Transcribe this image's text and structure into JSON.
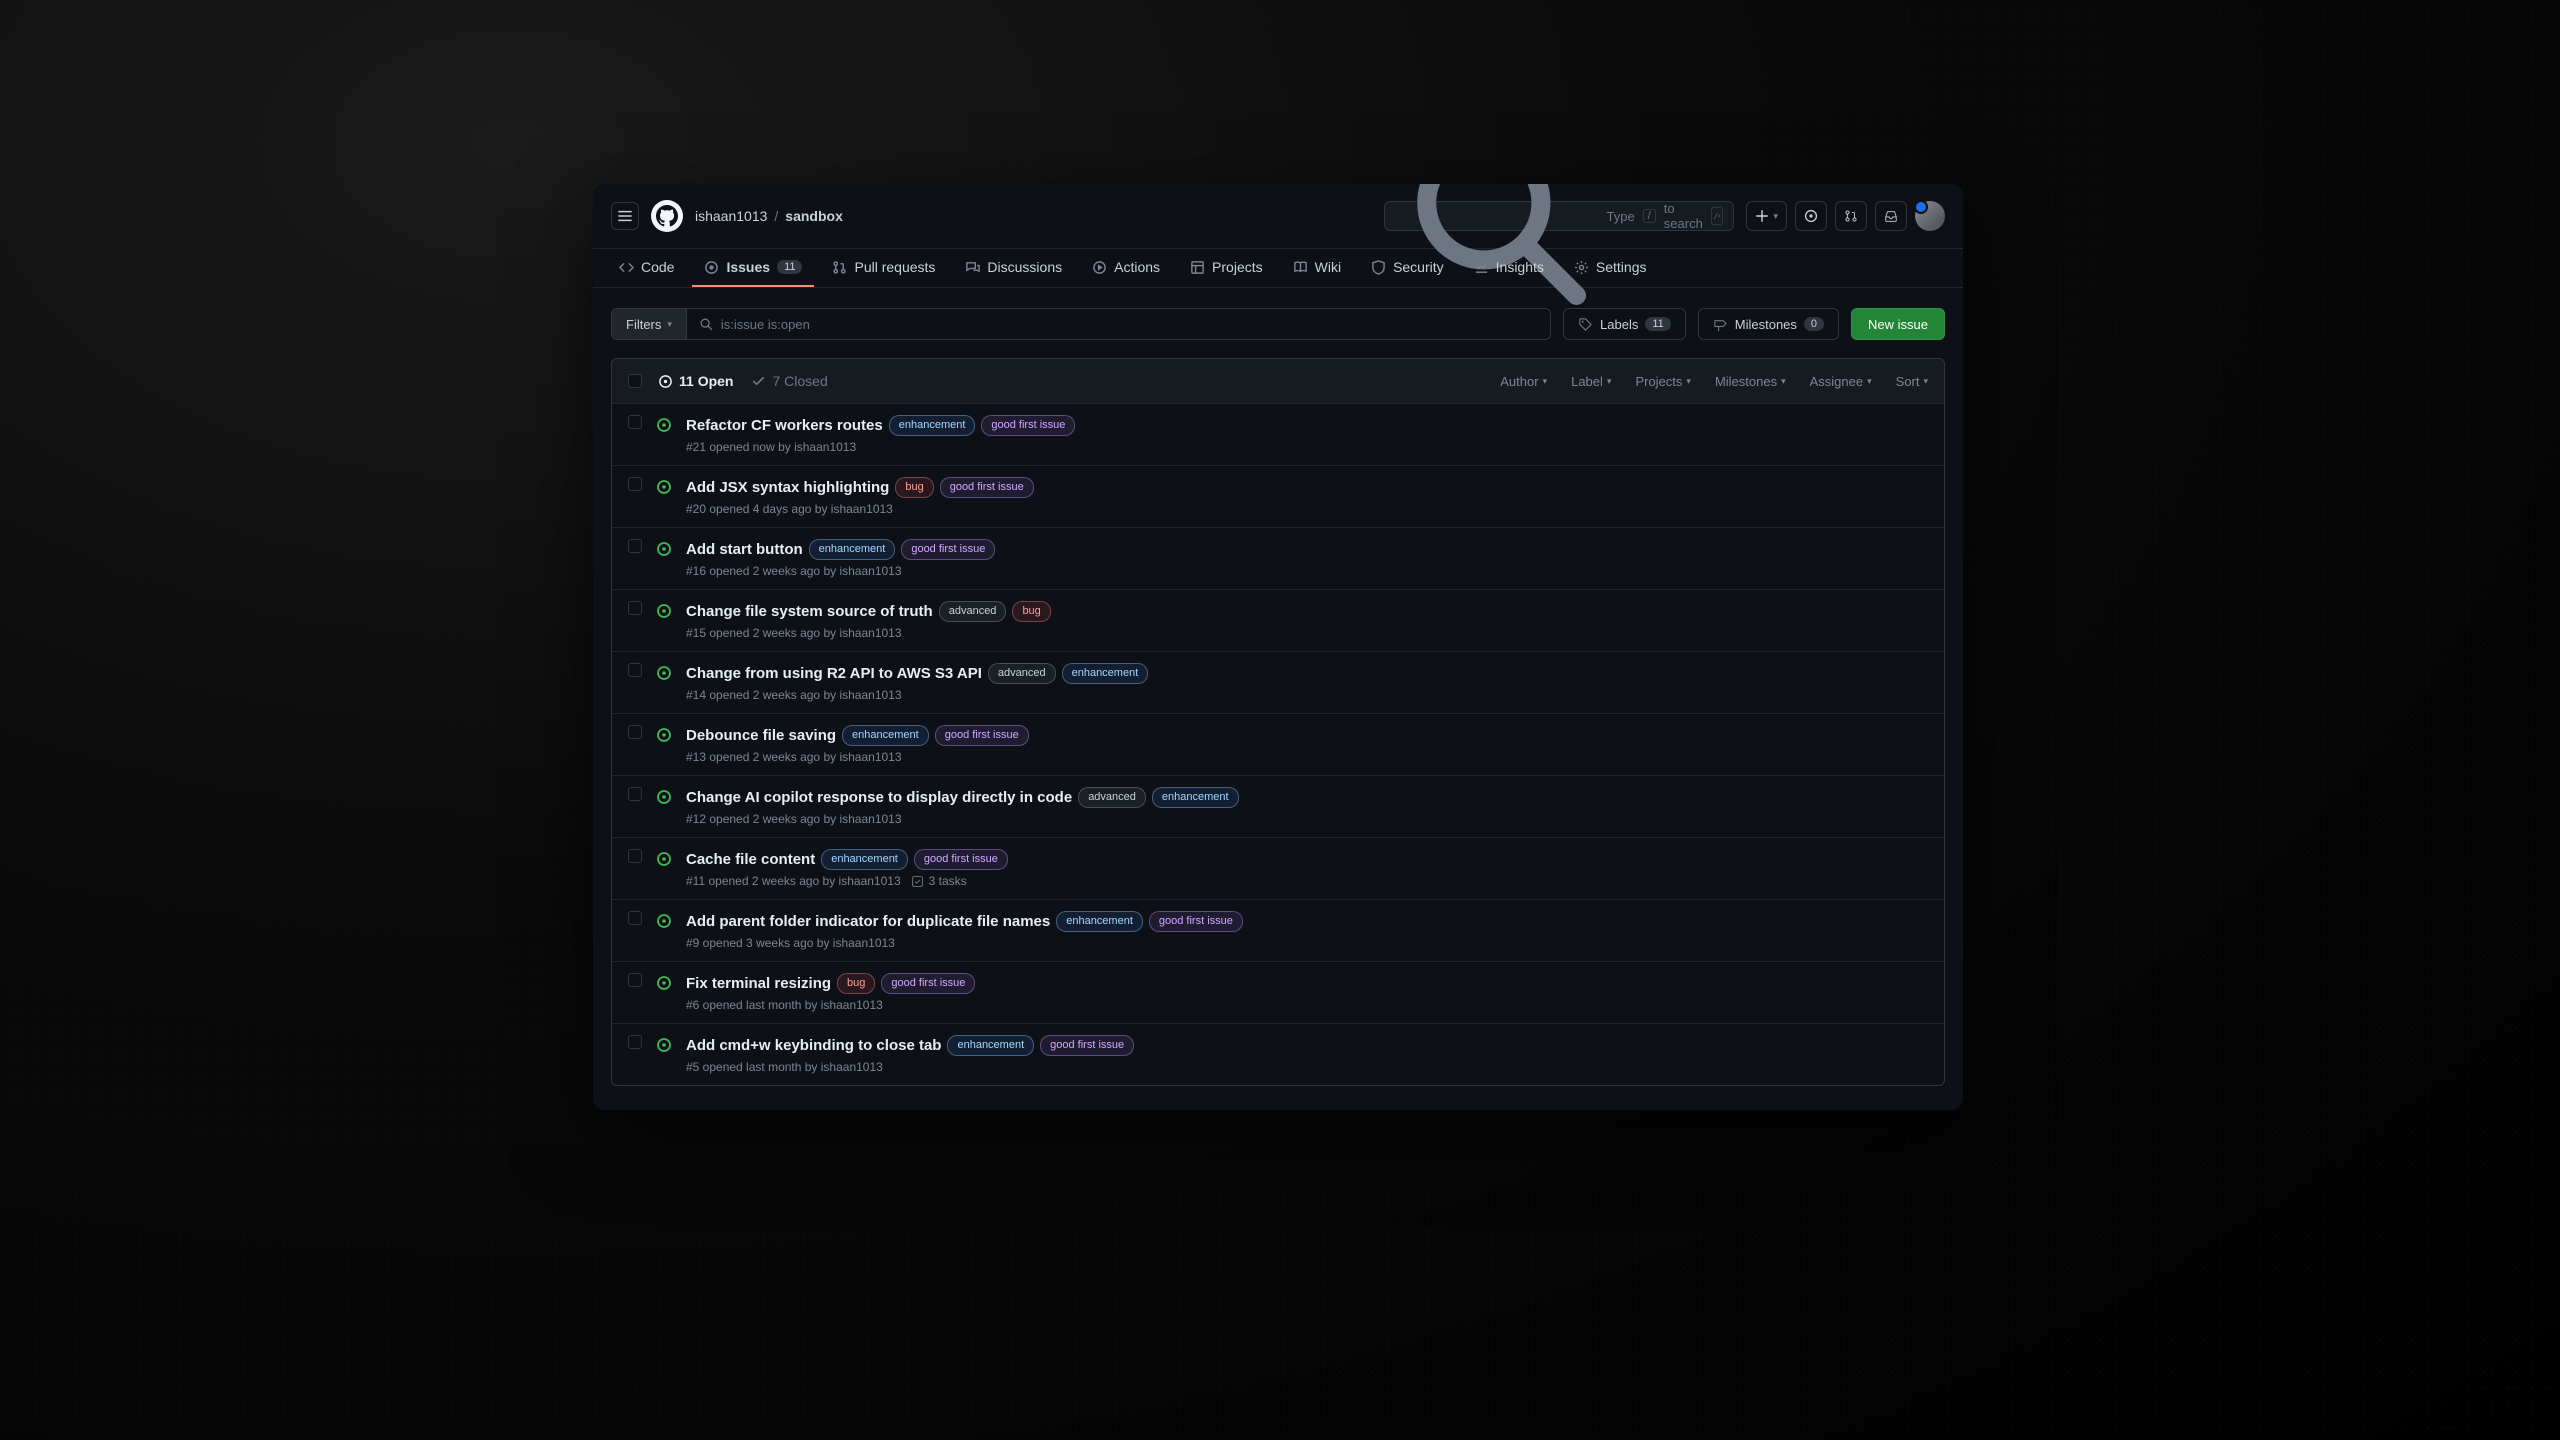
{
  "breadcrumb": {
    "owner": "ishaan1013",
    "repo": "sandbox",
    "sep": "/"
  },
  "search": {
    "prefix": "Type",
    "kbd": "/",
    "suffix": "to search"
  },
  "tabs": {
    "code": "Code",
    "issues": "Issues",
    "issues_count": "11",
    "pulls": "Pull requests",
    "discussions": "Discussions",
    "actions": "Actions",
    "projects": "Projects",
    "wiki": "Wiki",
    "security": "Security",
    "insights": "Insights",
    "settings": "Settings"
  },
  "toolbar": {
    "filters": "Filters",
    "query": "is:issue is:open",
    "labels": "Labels",
    "labels_count": "11",
    "milestones": "Milestones",
    "milestones_count": "0",
    "new_issue": "New issue"
  },
  "list_header": {
    "open": "11 Open",
    "closed": "7 Closed",
    "author": "Author",
    "label": "Label",
    "projects": "Projects",
    "milestones": "Milestones",
    "assignee": "Assignee",
    "sort": "Sort"
  },
  "labels": {
    "enhancement": "enhancement",
    "bug": "bug",
    "good_first_issue": "good first issue",
    "advanced": "advanced"
  },
  "issues": [
    {
      "title": "Refactor CF workers routes",
      "labels": [
        "enhancement",
        "good_first_issue"
      ],
      "meta": "#21 opened now by ishaan1013"
    },
    {
      "title": "Add JSX syntax highlighting",
      "labels": [
        "bug",
        "good_first_issue"
      ],
      "meta": "#20 opened 4 days ago by ishaan1013"
    },
    {
      "title": "Add start button",
      "labels": [
        "enhancement",
        "good_first_issue"
      ],
      "meta": "#16 opened 2 weeks ago by ishaan1013"
    },
    {
      "title": "Change file system source of truth",
      "labels": [
        "advanced",
        "bug"
      ],
      "meta": "#15 opened 2 weeks ago by ishaan1013"
    },
    {
      "title": "Change from using R2 API to AWS S3 API",
      "labels": [
        "advanced",
        "enhancement"
      ],
      "meta": "#14 opened 2 weeks ago by ishaan1013"
    },
    {
      "title": "Debounce file saving",
      "labels": [
        "enhancement",
        "good_first_issue"
      ],
      "meta": "#13 opened 2 weeks ago by ishaan1013"
    },
    {
      "title": "Change AI copilot response to display directly in code",
      "labels": [
        "advanced",
        "enhancement"
      ],
      "meta": "#12 opened 2 weeks ago by ishaan1013"
    },
    {
      "title": "Cache file content",
      "labels": [
        "enhancement",
        "good_first_issue"
      ],
      "meta": "#11 opened 2 weeks ago by ishaan1013",
      "tasks": "3 tasks"
    },
    {
      "title": "Add parent folder indicator for duplicate file names",
      "labels": [
        "enhancement",
        "good_first_issue"
      ],
      "meta": "#9 opened 3 weeks ago by ishaan1013"
    },
    {
      "title": "Fix terminal resizing",
      "labels": [
        "bug",
        "good_first_issue"
      ],
      "meta": "#6 opened last month by ishaan1013"
    },
    {
      "title": "Add cmd+w keybinding to close tab",
      "labels": [
        "enhancement",
        "good_first_issue"
      ],
      "meta": "#5 opened last month by ishaan1013"
    }
  ]
}
